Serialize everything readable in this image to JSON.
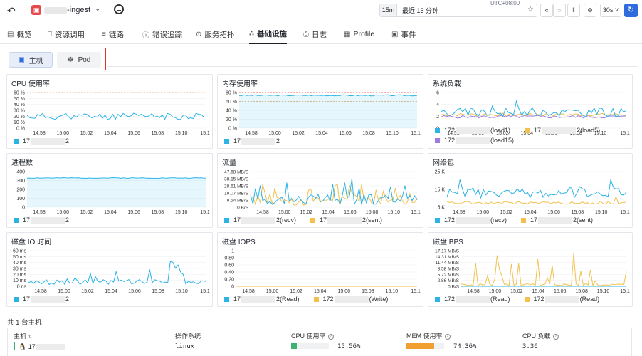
{
  "header": {
    "app_name": "-ingest",
    "back_icon": "back-arrow-icon",
    "timezone": "UTC+08:00",
    "range_short": "15m",
    "range_label": "最近 15 分钟",
    "refresh_interval": "30s"
  },
  "tabs": [
    {
      "label": "概览",
      "icon": "overview-icon"
    },
    {
      "label": "资源调用",
      "icon": "resource-icon"
    },
    {
      "label": "链路",
      "icon": "trace-icon"
    },
    {
      "label": "错误追踪",
      "icon": "error-icon"
    },
    {
      "label": "服务拓扑",
      "icon": "topology-icon"
    },
    {
      "label": "基础设施",
      "icon": "infra-icon",
      "active": true
    },
    {
      "label": "日志",
      "icon": "log-icon"
    },
    {
      "label": "Profile",
      "icon": "profile-icon"
    },
    {
      "label": "事件",
      "icon": "event-icon"
    }
  ],
  "segment": {
    "host": "主机",
    "pod": "Pod"
  },
  "x_ticks": [
    "14:58",
    "15:00",
    "15:02",
    "15:04",
    "15:06",
    "15:08",
    "15:10",
    "15:1"
  ],
  "cards": {
    "cpu": {
      "title": "CPU 使用率",
      "yticks": [
        "60 %",
        "50 %",
        "40 %",
        "30 %",
        "20 %",
        "10 %",
        "0 %"
      ],
      "legend": [
        "17",
        "2"
      ]
    },
    "mem": {
      "title": "内存使用率",
      "yticks": [
        "80 %",
        "60 %",
        "40 %",
        "20 %",
        "0 %"
      ],
      "legend": [
        "17",
        "2"
      ]
    },
    "load": {
      "title": "系统负载",
      "yticks": [
        "6",
        "4",
        "2",
        "0"
      ],
      "legend": [
        "172",
        "(load1)",
        "17",
        "2(load5)",
        "172",
        "(load15)"
      ]
    },
    "proc": {
      "title": "进程数",
      "yticks": [
        "400",
        "300",
        "200",
        "100",
        "0"
      ],
      "legend": [
        "17",
        "2"
      ]
    },
    "traffic": {
      "title": "流量",
      "yticks": [
        "47.68 MB/S",
        "38.15 MB/S",
        "28.61 MB/S",
        "19.07 MB/S",
        "9.54 MB/S",
        "0 B/S"
      ],
      "legend": [
        "17",
        "2(recv)",
        "17",
        "2(sent)"
      ]
    },
    "packets": {
      "title": "网络包",
      "yticks": [
        "25 K",
        "15 K",
        "5 K"
      ],
      "legend": [
        "172",
        "(recv)",
        "17",
        "2(sent)"
      ]
    },
    "diskio": {
      "title": "磁盘 IO 时间",
      "yticks": [
        "60 ms",
        "50 ms",
        "40 ms",
        "30 ms",
        "20 ms",
        "10 ms",
        "0 ns"
      ],
      "legend": [
        "17",
        "2"
      ]
    },
    "iops": {
      "title": "磁盘 IOPS",
      "yticks": [
        "1",
        "0.80",
        "0.60",
        "0.40",
        "0.20",
        "0"
      ],
      "legend": [
        "17",
        "2(Read)",
        "172",
        "(Write)"
      ]
    },
    "bps": {
      "title": "磁盘 BPS",
      "yticks": [
        "17.17 MB/S",
        "14.31 MB/S",
        "11.44 MB/S",
        "8.58 MB/S",
        "5.72 MB/S",
        "2.86 MB/S",
        "0 B/S"
      ],
      "legend": [
        "172",
        "(Read)",
        "172",
        "(Read)"
      ]
    }
  },
  "colors": {
    "blue": "#2bb3e6",
    "yellow": "#f2c14e",
    "orange": "#f0a45a",
    "purple": "#9b7be0",
    "red": "#e6332a",
    "green": "#3cb371"
  },
  "table": {
    "total": "共 1 台主机",
    "headers": {
      "host": "主机",
      "os": "操作系统",
      "cpu": "CPU 使用率",
      "mem": "MEM 使用率",
      "load": "CPU 负载"
    },
    "row": {
      "host": "17",
      "os": "linux",
      "cpu": "15.56%",
      "mem": "74.36%",
      "load": "3.36",
      "cpu_pct": 15.56,
      "mem_pct": 74.36
    }
  }
}
